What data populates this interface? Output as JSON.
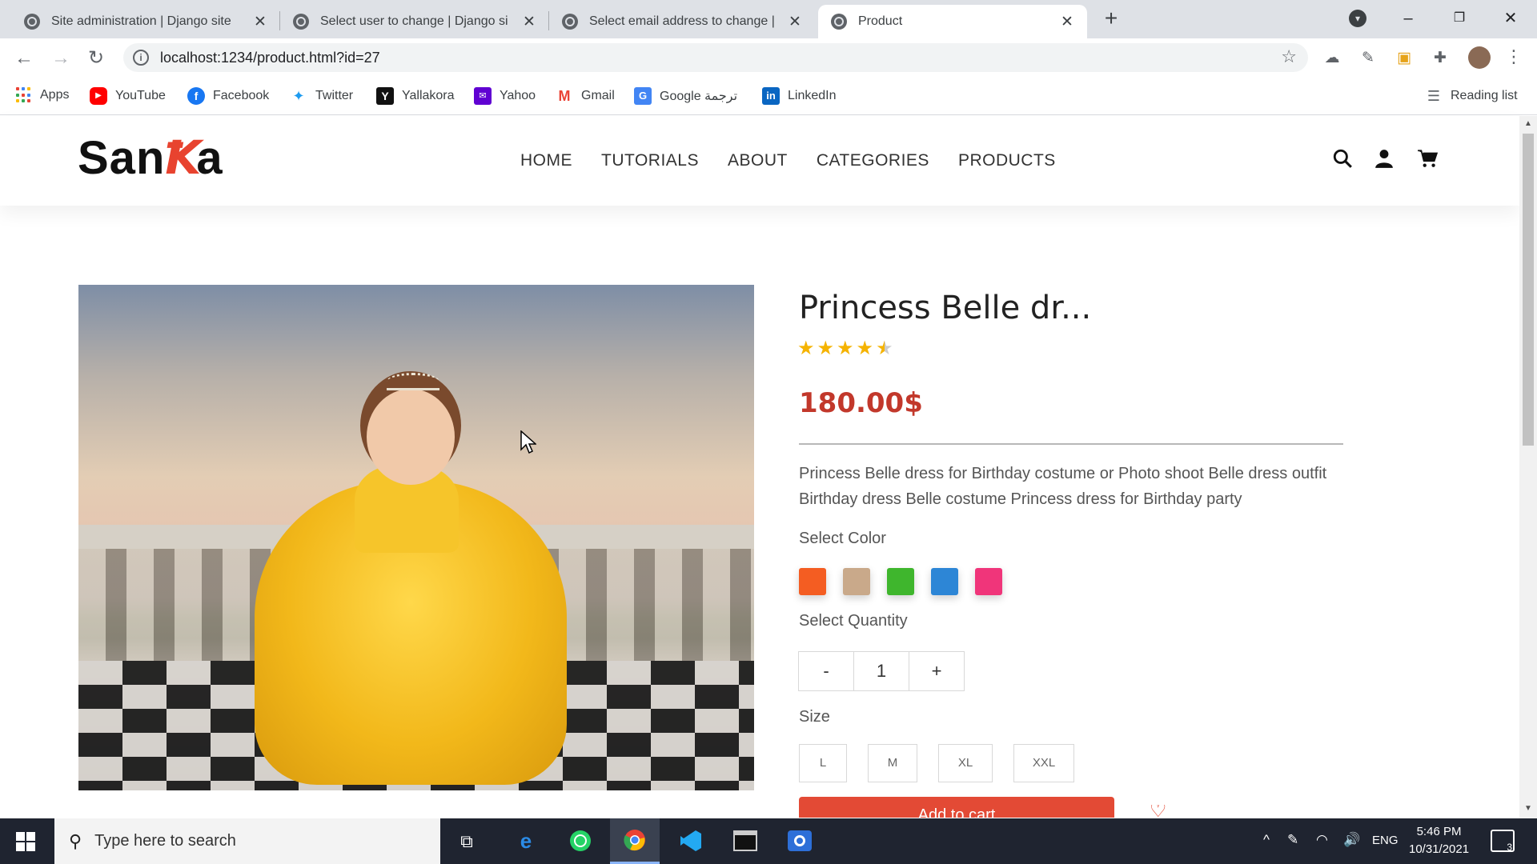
{
  "browser": {
    "tabs": [
      {
        "title": "Site administration | Django site"
      },
      {
        "title": "Select user to change | Django si"
      },
      {
        "title": "Select email address to change |"
      },
      {
        "title": "Product"
      }
    ],
    "url": "localhost:1234/product.html?id=27",
    "bookmarks": [
      "Apps",
      "YouTube",
      "Facebook",
      "Twitter",
      "Yallakora",
      "Yahoo",
      "Gmail",
      "Google ترجمة",
      "LinkedIn"
    ],
    "reading_list": "Reading list"
  },
  "site": {
    "logo_left": "San",
    "logo_mark": "Ꝁ",
    "logo_right": "a",
    "nav": [
      "HOME",
      "TUTORIALS",
      "ABOUT",
      "CATEGORIES",
      "PRODUCTS"
    ]
  },
  "product": {
    "title": "Princess Belle dr...",
    "rating": 4.5,
    "price": "180.00$",
    "description": "Princess Belle dress for Birthday costume or Photo shoot Belle dress outfit Birthday dress Belle costume Princess dress for Birthday party",
    "select_color_label": "Select Color",
    "colors": [
      "#f45d22",
      "#c9a98a",
      "#3fb62d",
      "#2d86d6",
      "#f0357a"
    ],
    "select_quantity_label": "Select Quantity",
    "qty_minus": "-",
    "quantity": "1",
    "qty_plus": "+",
    "size_label": "Size",
    "sizes": [
      "L",
      "M",
      "XL",
      "XXL"
    ],
    "add_to_cart": "Add to cart"
  },
  "taskbar": {
    "search_placeholder": "Type here to search",
    "language": "ENG",
    "time": "5:46 PM",
    "date": "10/31/2021",
    "notifications": "3"
  }
}
